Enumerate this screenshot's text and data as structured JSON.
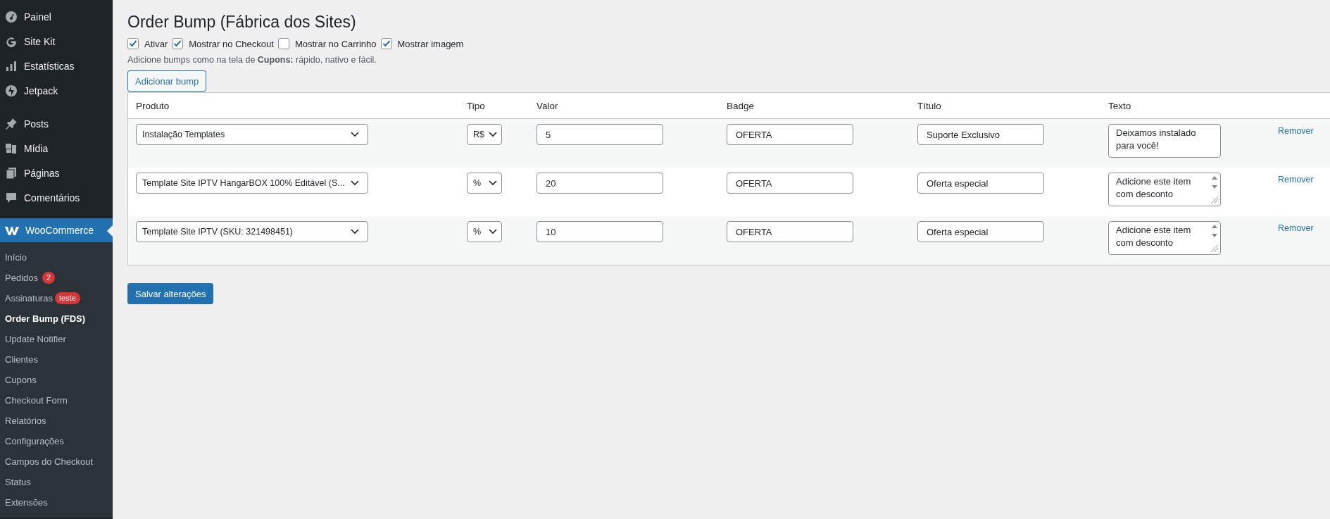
{
  "sidebar": {
    "menu_groups": [
      [
        {
          "label": "Painel",
          "selected": false
        },
        {
          "label": "Site Kit",
          "selected": false
        },
        {
          "label": "Estatísticas",
          "selected": false
        },
        {
          "label": "Jetpack",
          "selected": false
        }
      ],
      [
        {
          "label": "Posts",
          "selected": false
        },
        {
          "label": "Mídia",
          "selected": false
        },
        {
          "label": "Páginas",
          "selected": false
        },
        {
          "label": "Comentários",
          "selected": false
        }
      ],
      [
        {
          "label": "WooCommerce",
          "selected": true
        }
      ]
    ],
    "submenu": [
      {
        "label": "Início",
        "selected": false
      },
      {
        "label": "Pedidos",
        "selected": false,
        "badge": "2"
      },
      {
        "label": "Assinaturas",
        "selected": false,
        "badge": "teste"
      },
      {
        "label": "Order Bump (FDS)",
        "selected": true
      },
      {
        "label": "Update Notifier",
        "selected": false
      },
      {
        "label": "Clientes",
        "selected": false
      },
      {
        "label": "Cupons",
        "selected": false
      },
      {
        "label": "Checkout Form",
        "selected": false
      },
      {
        "label": "Relatórios",
        "selected": false
      },
      {
        "label": "Configurações",
        "selected": false
      },
      {
        "label": "Campos do Checkout",
        "selected": false
      },
      {
        "label": "Status",
        "selected": false
      },
      {
        "label": "Extensões",
        "selected": false
      }
    ]
  },
  "page": {
    "title": "Order Bump (Fábrica dos Sites)",
    "options": [
      {
        "label": "Ativar",
        "checked": true
      },
      {
        "label": "Mostrar no Checkout",
        "checked": true
      },
      {
        "label": "Mostrar no Carrinho",
        "checked": false
      },
      {
        "label": "Mostrar imagem",
        "checked": true
      }
    ],
    "description": "Adicione bumps como na tela de **Cupons:** rápido, nativo e fácil.",
    "add_button": "Adicionar bump",
    "table": {
      "columns": [
        "Produto",
        "Tipo",
        "Valor",
        "Badge",
        "Título",
        "Texto"
      ],
      "rows": [
        {
          "produto": "Instalação Templates",
          "tipo": "R$",
          "valor": "5",
          "badge": "OFERTA",
          "titulo": "Suporte Exclusivo",
          "texto": "Deixamos instalado para você!",
          "texto_scrollbar": false,
          "remove": "Remover"
        },
        {
          "produto": "Template Site IPTV HangarBOX 100% Editável (S...",
          "tipo": "%",
          "valor": "20",
          "badge": "OFERTA",
          "titulo": "Oferta especial",
          "texto": "Adicione este item com desconto",
          "texto_scrollbar": true,
          "remove": "Remover"
        },
        {
          "produto": "Template Site IPTV (SKU: 321498451)",
          "tipo": "%",
          "valor": "10",
          "badge": "OFERTA",
          "titulo": "Oferta especial",
          "texto": "Adicione este item com desconto",
          "texto_scrollbar": true,
          "remove": "Remover"
        }
      ]
    },
    "save_button": "Salvar alterações"
  }
}
